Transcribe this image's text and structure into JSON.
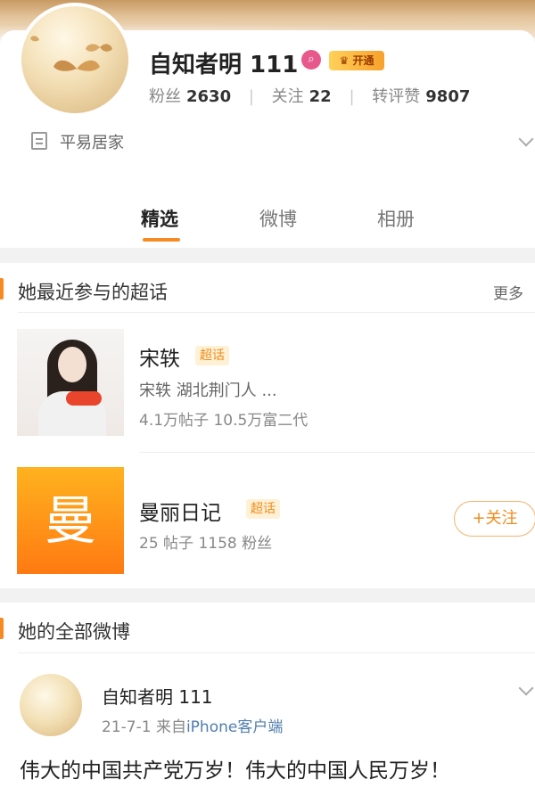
{
  "profile": {
    "name": "自知者明 111",
    "badge_open": "开通",
    "stats": {
      "fans_label": "粉丝",
      "fans_value": "2630",
      "following_label": "关注",
      "following_value": "22",
      "interactions_label": "转评赞",
      "interactions_value": "9807"
    },
    "bio": "平易居家"
  },
  "tabs": [
    {
      "label": "精选",
      "active": true
    },
    {
      "label": "微博",
      "active": false
    },
    {
      "label": "相册",
      "active": false
    }
  ],
  "supertopics_section": {
    "title": "她最近参与的超话",
    "more": "更多",
    "items": [
      {
        "name": "宋轶",
        "tag": "超话",
        "desc": "宋轶 湖北荆门人 ...",
        "stats": "4.1万帖子 10.5万富二代"
      },
      {
        "name": "曼丽日记",
        "tag": "超话",
        "icon_char": "曼",
        "stats": "25 帖子 1158 粉丝",
        "follow_label": "+关注"
      }
    ]
  },
  "posts_section": {
    "title": "她的全部微博",
    "post": {
      "author": "自知者明 111",
      "date": "21-7-1",
      "from_prefix": "来自",
      "source": "iPhone客户端",
      "text": "伟大的中国共产党万岁！伟大的中国人民万岁！"
    }
  },
  "colors": {
    "accent": "#f68b23",
    "link": "#507daf",
    "tag_bg": "#fff1d6"
  },
  "icons": [
    "search-badge-icon",
    "vip-crown-icon",
    "document-icon",
    "chevron-down-icon",
    "plus-icon"
  ]
}
